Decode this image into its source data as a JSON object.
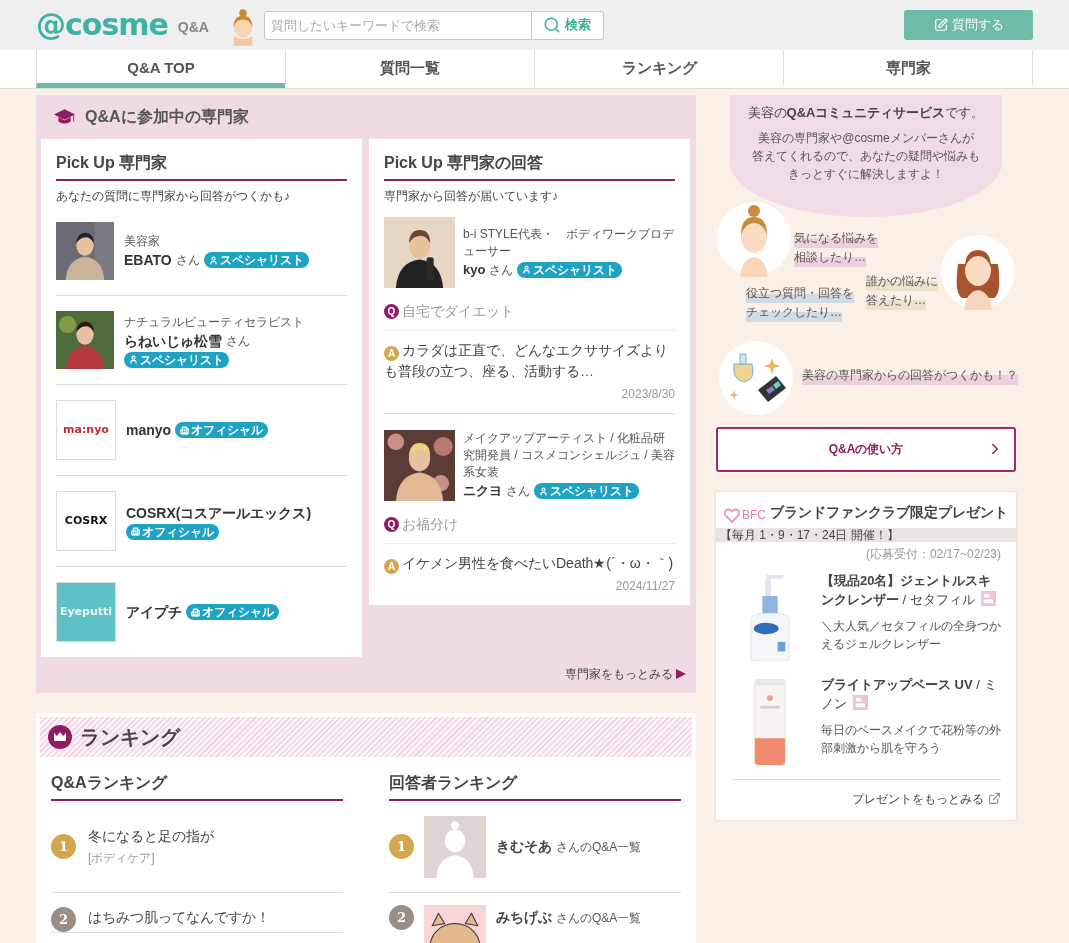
{
  "header": {
    "logo": "@cosme",
    "logo_sub": "Q&A",
    "search": {
      "placeholder": "質問したいキーワードで検索",
      "button": "検索"
    },
    "ask_button": "質問する"
  },
  "nav": [
    {
      "label": "Q&A TOP",
      "selected": true
    },
    {
      "label": "質問一覧",
      "selected": false
    },
    {
      "label": "ランキング",
      "selected": false
    },
    {
      "label": "専門家",
      "selected": false
    }
  ],
  "experts_section": {
    "title": "Q&Aに参加中の専門家",
    "pickup": {
      "title": "Pick Up 専門家",
      "subtitle": "あなたの質問に専門家から回答がつくかも♪",
      "experts": [
        {
          "role": "美容家",
          "name": "EBATO",
          "suffix": "さん",
          "badge": {
            "kind": "specialist",
            "label": "スペシャリスト"
          }
        },
        {
          "role": "ナチュラルビューティセラピスト",
          "name": "らねいじゅ松雪",
          "suffix": "さん",
          "badge": {
            "kind": "specialist",
            "label": "スペシャリスト"
          }
        },
        {
          "thumb": {
            "kind": "logo",
            "text": "ma:nyo",
            "color": "#c8262f"
          },
          "name": "manyo",
          "badge": {
            "kind": "official",
            "label": "オフィシャル"
          }
        },
        {
          "thumb": {
            "kind": "logo",
            "text": "COSRX",
            "color": "#111111"
          },
          "name": "COSRX(コスアールエックス)",
          "badge": {
            "kind": "official",
            "label": "オフィシャル"
          }
        },
        {
          "thumb": {
            "kind": "logo",
            "text": "Eyeputti",
            "color": "#e8f6f7",
            "tile": {
              "color": "#5fc1c8"
            }
          },
          "name": "アイプチ",
          "badge": {
            "kind": "official",
            "label": "オフィシャル"
          }
        }
      ]
    },
    "answers": {
      "title": "Pick Up 専門家の回答",
      "subtitle": "専門家から回答が届いています♪",
      "items": [
        {
          "role": "b-i STYLE代表・　ボディワークプロデューサー",
          "name": "kyo",
          "suffix": "さん",
          "badge": {
            "kind": "specialist",
            "label": "スペシャリスト"
          },
          "q_mark": "Q",
          "question": "自宅でダイエット",
          "a_mark": "A",
          "answer": "カラダは正直で、どんなエクササイズよりも普段の立つ、座る、活動する…",
          "date": "2023/8/30"
        },
        {
          "role": "メイクアップアーティスト / 化粧品研究開発員 / コスメコンシェルジュ / 美容系女装",
          "name": "ニクヨ",
          "suffix": "さん",
          "badge": {
            "kind": "specialist",
            "label": "スペシャリスト"
          },
          "q_mark": "Q",
          "question": "お福分け",
          "a_mark": "A",
          "answer": "イケメン男性を食べたいDeath★(´・ω・｀)",
          "date": "2024/11/27"
        }
      ]
    },
    "more_link": "専門家をもっとみる"
  },
  "ranking": {
    "title": "ランキング",
    "qa": {
      "title": "Q&Aランキング",
      "items": [
        {
          "rank": "1",
          "color": "#d4a74f",
          "text": "冬になると足の指が",
          "category": "[ボディケア]"
        },
        {
          "rank": "2",
          "color": "#9a8f86",
          "text": "はちみつ肌ってなんですか！"
        }
      ]
    },
    "answerers": {
      "title": "回答者ランキング",
      "items": [
        {
          "rank": "1",
          "color": "#d4a74f",
          "kind": "default_avatar",
          "name": "きむそあ",
          "suffix": "さんのQ&A一覧"
        },
        {
          "rank": "2",
          "color": "#9a8f86",
          "kind": "animal_avatar",
          "name": "みちげぶ",
          "suffix": "さんのQ&A一覧"
        }
      ]
    }
  },
  "about": {
    "headline": "美容の**Q&Aコミュニティサービス**です。",
    "body_lines": [
      "美容の専門家や@cosmeメンバーさんが",
      "答えてくれるので、あなたの疑問や悩みも",
      "きっとすぐに解決しますよ！"
    ],
    "captions": [
      {
        "lines": [
          "気になる悩みを",
          "相談したり…"
        ],
        "color": "#ecd0de"
      },
      {
        "lines": [
          "役立つ質問・回答を",
          "チェックしたり…"
        ],
        "color": "#d3dbe2"
      },
      {
        "lines": [
          "誰かの悩みに",
          "答えたり…"
        ],
        "color": "#efe0c9"
      },
      {
        "lines": [
          "美容の専門家からの回答がつくかも！？"
        ],
        "color": "#ecd0de"
      }
    ],
    "howto_button": "Q&Aの使い方"
  },
  "present": {
    "logo": "BFC",
    "title": "ブランドファンクラブ限定プレゼント",
    "schedule": "【毎月 1・9・17・24日 開催！】",
    "period": "(応募受付：02/17~02/23)",
    "items": [
      {
        "kind": "pump_bottle",
        "title": "**【現品20名】ジェントルスキンクレンザー** / セタフィル",
        "desc": "＼大人気／セタフィルの全身つかえるジェルクレンザー"
      },
      {
        "kind": "tube",
        "title": "**ブライトアップベース UV** / ミノン",
        "desc": "毎日のベースメイクで花粉等の外部刺激から肌を守ろう"
      }
    ],
    "more_link": "プレゼントをもっとみる"
  }
}
